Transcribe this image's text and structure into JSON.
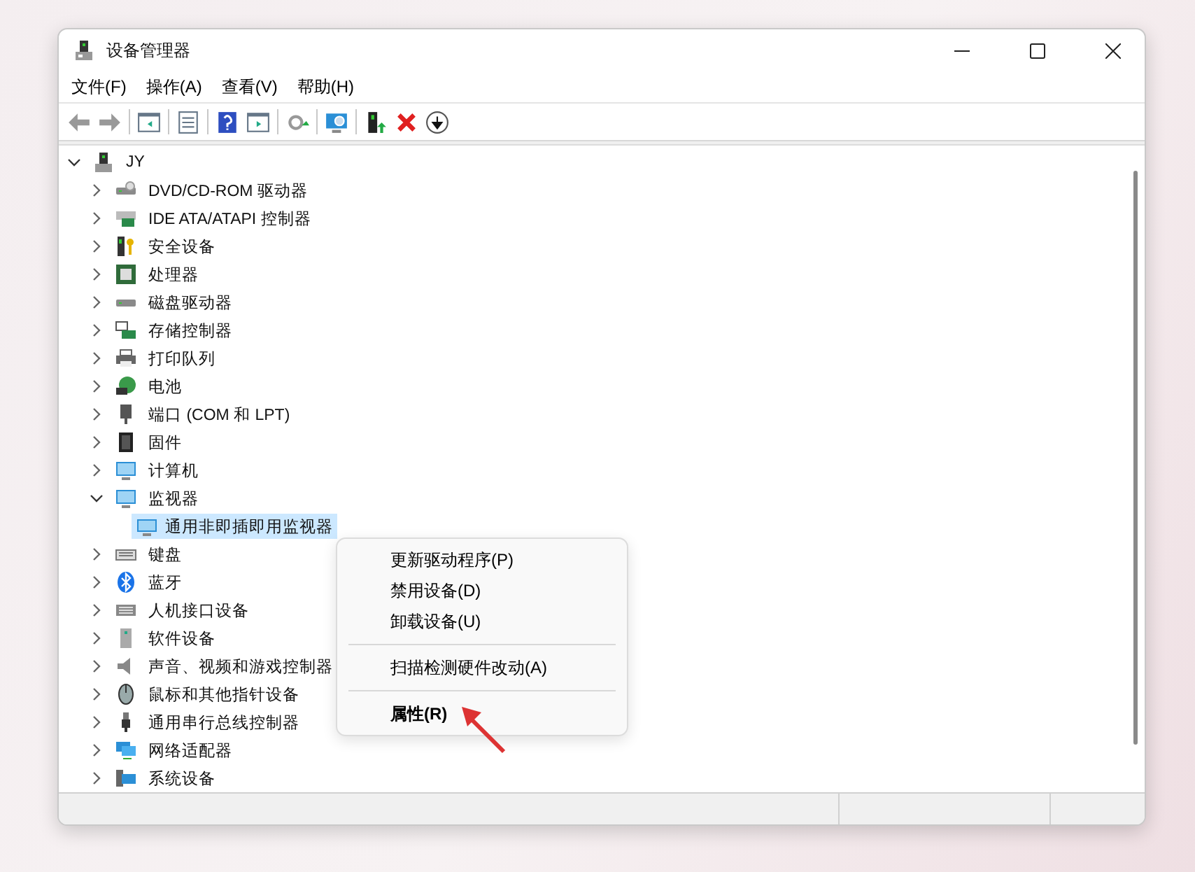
{
  "window": {
    "title": "设备管理器"
  },
  "menu_bar": [
    {
      "label": "文件(F)"
    },
    {
      "label": "操作(A)"
    },
    {
      "label": "查看(V)"
    },
    {
      "label": "帮助(H)"
    }
  ],
  "tree": {
    "label": "JY",
    "expanded": true,
    "children": [
      {
        "label": "DVD/CD-ROM 驱动器",
        "expanded": false,
        "selected": false
      },
      {
        "label": "IDE ATA/ATAPI 控制器",
        "expanded": false,
        "selected": false
      },
      {
        "label": "安全设备",
        "expanded": false,
        "selected": false
      },
      {
        "label": "处理器",
        "expanded": false,
        "selected": false
      },
      {
        "label": "磁盘驱动器",
        "expanded": false,
        "selected": false
      },
      {
        "label": "存储控制器",
        "expanded": false,
        "selected": false
      },
      {
        "label": "打印队列",
        "expanded": false,
        "selected": false
      },
      {
        "label": "电池",
        "expanded": false,
        "selected": false
      },
      {
        "label": "端口 (COM 和 LPT)",
        "expanded": false,
        "selected": false
      },
      {
        "label": "固件",
        "expanded": false,
        "selected": false
      },
      {
        "label": "计算机",
        "expanded": false,
        "selected": false
      },
      {
        "label": "监视器",
        "expanded": true,
        "selected": false,
        "children": [
          {
            "label": "通用非即插即用监视器",
            "selected": true
          }
        ]
      },
      {
        "label": "键盘",
        "expanded": false,
        "selected": false
      },
      {
        "label": "蓝牙",
        "expanded": false,
        "selected": false
      },
      {
        "label": "人机接口设备",
        "expanded": false,
        "selected": false
      },
      {
        "label": "软件设备",
        "expanded": false,
        "selected": false
      },
      {
        "label": "声音、视频和游戏控制器",
        "expanded": false,
        "selected": false
      },
      {
        "label": "鼠标和其他指针设备",
        "expanded": false,
        "selected": false
      },
      {
        "label": "通用串行总线控制器",
        "expanded": false,
        "selected": false
      },
      {
        "label": "网络适配器",
        "expanded": false,
        "selected": false
      },
      {
        "label": "系统设备",
        "expanded": false,
        "selected": false
      }
    ]
  },
  "context_menu": [
    {
      "kind": "command",
      "label": "更新驱动程序(P)",
      "default": false
    },
    {
      "kind": "command",
      "label": "禁用设备(D)",
      "default": false
    },
    {
      "kind": "command",
      "label": "卸载设备(U)",
      "default": false
    },
    {
      "kind": "separator"
    },
    {
      "kind": "command",
      "label": "扫描检测硬件改动(A)",
      "default": false
    },
    {
      "kind": "separator"
    },
    {
      "kind": "command",
      "label": "属性(R)",
      "default": true
    }
  ]
}
